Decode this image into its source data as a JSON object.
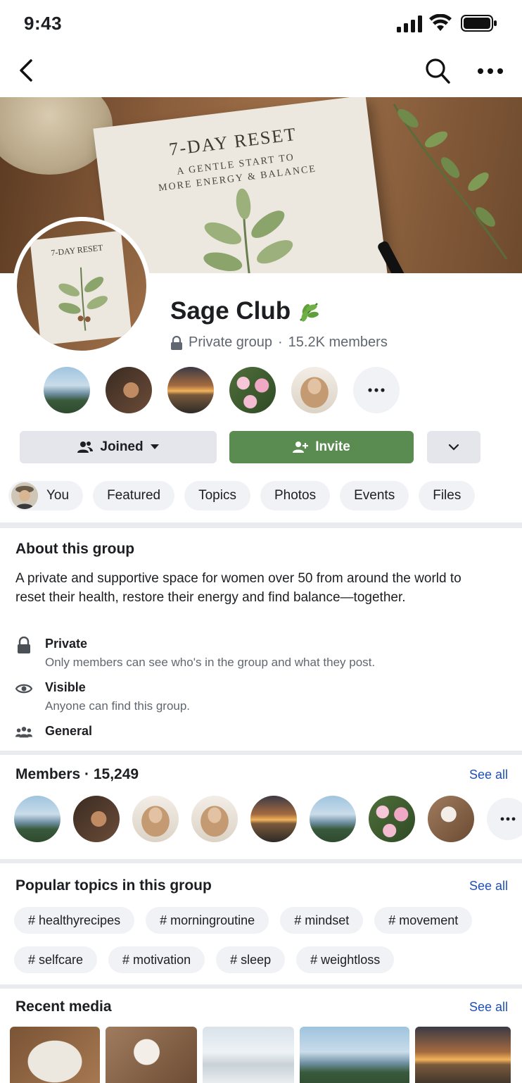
{
  "status_bar": {
    "time": "9:43"
  },
  "cover": {
    "book_title": "7-DAY RESET",
    "book_subtitle_line1": "A GENTLE START TO",
    "book_subtitle_line2": "MORE ENERGY & BALANCE",
    "avatar_book_title": "7-DAY RESET"
  },
  "group": {
    "name": "Sage Club",
    "privacy": "Private group",
    "separator": "·",
    "member_count": "15.2K members"
  },
  "actions": {
    "joined_label": "Joined",
    "invite_label": "Invite"
  },
  "tabs": [
    {
      "label": "You"
    },
    {
      "label": "Featured"
    },
    {
      "label": "Topics"
    },
    {
      "label": "Photos"
    },
    {
      "label": "Events"
    },
    {
      "label": "Files"
    }
  ],
  "about": {
    "title": "About this group",
    "description": "A private and supportive space for women over 50 from around the world to reset their health, restore their energy and find balance—together.",
    "private_label": "Private",
    "private_desc": "Only members can see who's in the group and what they post.",
    "visible_label": "Visible",
    "visible_desc": "Anyone can find this group.",
    "general_label": "General"
  },
  "members": {
    "title": "Members · 15,249",
    "see_all": "See all"
  },
  "topics": {
    "title": "Popular topics in this group",
    "see_all": "See all",
    "row1": [
      "# healthyrecipes",
      "# morningroutine",
      "# mindset",
      "# movement"
    ],
    "row2": [
      "# selfcare",
      "# motivation",
      "# sleep",
      "# weightloss"
    ]
  },
  "media": {
    "title": "Recent media",
    "see_all": "See all"
  },
  "colors": {
    "invite_green": "#5a8c52",
    "link_blue": "#1f4fb5"
  }
}
